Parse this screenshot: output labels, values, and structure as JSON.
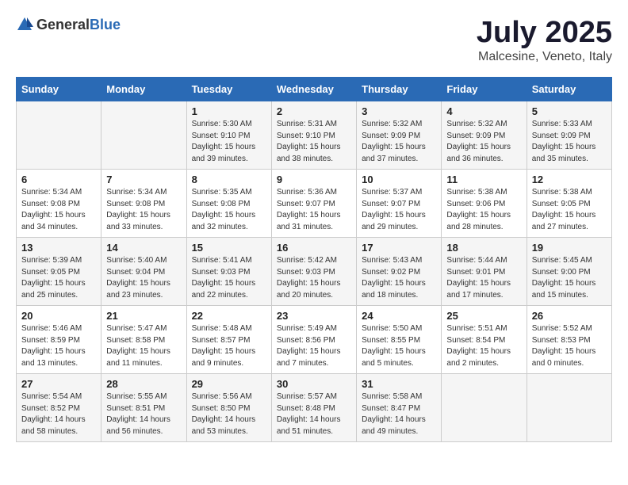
{
  "header": {
    "logo_general": "General",
    "logo_blue": "Blue",
    "title": "July 2025",
    "subtitle": "Malcesine, Veneto, Italy"
  },
  "weekdays": [
    "Sunday",
    "Monday",
    "Tuesday",
    "Wednesday",
    "Thursday",
    "Friday",
    "Saturday"
  ],
  "weeks": [
    [
      {
        "day": "",
        "detail": ""
      },
      {
        "day": "",
        "detail": ""
      },
      {
        "day": "1",
        "detail": "Sunrise: 5:30 AM\nSunset: 9:10 PM\nDaylight: 15 hours\nand 39 minutes."
      },
      {
        "day": "2",
        "detail": "Sunrise: 5:31 AM\nSunset: 9:10 PM\nDaylight: 15 hours\nand 38 minutes."
      },
      {
        "day": "3",
        "detail": "Sunrise: 5:32 AM\nSunset: 9:09 PM\nDaylight: 15 hours\nand 37 minutes."
      },
      {
        "day": "4",
        "detail": "Sunrise: 5:32 AM\nSunset: 9:09 PM\nDaylight: 15 hours\nand 36 minutes."
      },
      {
        "day": "5",
        "detail": "Sunrise: 5:33 AM\nSunset: 9:09 PM\nDaylight: 15 hours\nand 35 minutes."
      }
    ],
    [
      {
        "day": "6",
        "detail": "Sunrise: 5:34 AM\nSunset: 9:08 PM\nDaylight: 15 hours\nand 34 minutes."
      },
      {
        "day": "7",
        "detail": "Sunrise: 5:34 AM\nSunset: 9:08 PM\nDaylight: 15 hours\nand 33 minutes."
      },
      {
        "day": "8",
        "detail": "Sunrise: 5:35 AM\nSunset: 9:08 PM\nDaylight: 15 hours\nand 32 minutes."
      },
      {
        "day": "9",
        "detail": "Sunrise: 5:36 AM\nSunset: 9:07 PM\nDaylight: 15 hours\nand 31 minutes."
      },
      {
        "day": "10",
        "detail": "Sunrise: 5:37 AM\nSunset: 9:07 PM\nDaylight: 15 hours\nand 29 minutes."
      },
      {
        "day": "11",
        "detail": "Sunrise: 5:38 AM\nSunset: 9:06 PM\nDaylight: 15 hours\nand 28 minutes."
      },
      {
        "day": "12",
        "detail": "Sunrise: 5:38 AM\nSunset: 9:05 PM\nDaylight: 15 hours\nand 27 minutes."
      }
    ],
    [
      {
        "day": "13",
        "detail": "Sunrise: 5:39 AM\nSunset: 9:05 PM\nDaylight: 15 hours\nand 25 minutes."
      },
      {
        "day": "14",
        "detail": "Sunrise: 5:40 AM\nSunset: 9:04 PM\nDaylight: 15 hours\nand 23 minutes."
      },
      {
        "day": "15",
        "detail": "Sunrise: 5:41 AM\nSunset: 9:03 PM\nDaylight: 15 hours\nand 22 minutes."
      },
      {
        "day": "16",
        "detail": "Sunrise: 5:42 AM\nSunset: 9:03 PM\nDaylight: 15 hours\nand 20 minutes."
      },
      {
        "day": "17",
        "detail": "Sunrise: 5:43 AM\nSunset: 9:02 PM\nDaylight: 15 hours\nand 18 minutes."
      },
      {
        "day": "18",
        "detail": "Sunrise: 5:44 AM\nSunset: 9:01 PM\nDaylight: 15 hours\nand 17 minutes."
      },
      {
        "day": "19",
        "detail": "Sunrise: 5:45 AM\nSunset: 9:00 PM\nDaylight: 15 hours\nand 15 minutes."
      }
    ],
    [
      {
        "day": "20",
        "detail": "Sunrise: 5:46 AM\nSunset: 8:59 PM\nDaylight: 15 hours\nand 13 minutes."
      },
      {
        "day": "21",
        "detail": "Sunrise: 5:47 AM\nSunset: 8:58 PM\nDaylight: 15 hours\nand 11 minutes."
      },
      {
        "day": "22",
        "detail": "Sunrise: 5:48 AM\nSunset: 8:57 PM\nDaylight: 15 hours\nand 9 minutes."
      },
      {
        "day": "23",
        "detail": "Sunrise: 5:49 AM\nSunset: 8:56 PM\nDaylight: 15 hours\nand 7 minutes."
      },
      {
        "day": "24",
        "detail": "Sunrise: 5:50 AM\nSunset: 8:55 PM\nDaylight: 15 hours\nand 5 minutes."
      },
      {
        "day": "25",
        "detail": "Sunrise: 5:51 AM\nSunset: 8:54 PM\nDaylight: 15 hours\nand 2 minutes."
      },
      {
        "day": "26",
        "detail": "Sunrise: 5:52 AM\nSunset: 8:53 PM\nDaylight: 15 hours\nand 0 minutes."
      }
    ],
    [
      {
        "day": "27",
        "detail": "Sunrise: 5:54 AM\nSunset: 8:52 PM\nDaylight: 14 hours\nand 58 minutes."
      },
      {
        "day": "28",
        "detail": "Sunrise: 5:55 AM\nSunset: 8:51 PM\nDaylight: 14 hours\nand 56 minutes."
      },
      {
        "day": "29",
        "detail": "Sunrise: 5:56 AM\nSunset: 8:50 PM\nDaylight: 14 hours\nand 53 minutes."
      },
      {
        "day": "30",
        "detail": "Sunrise: 5:57 AM\nSunset: 8:48 PM\nDaylight: 14 hours\nand 51 minutes."
      },
      {
        "day": "31",
        "detail": "Sunrise: 5:58 AM\nSunset: 8:47 PM\nDaylight: 14 hours\nand 49 minutes."
      },
      {
        "day": "",
        "detail": ""
      },
      {
        "day": "",
        "detail": ""
      }
    ]
  ]
}
